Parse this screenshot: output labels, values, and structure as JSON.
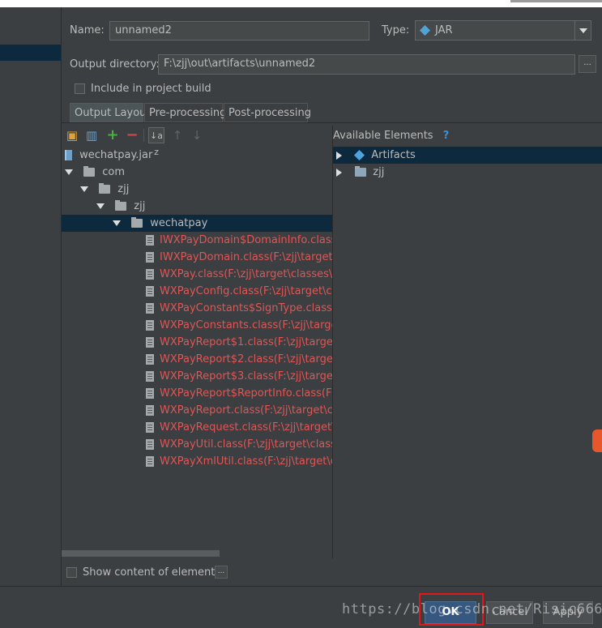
{
  "form": {
    "name_label": "Name:",
    "name_value": "unnamed2",
    "type_label": "Type:",
    "type_value": "JAR",
    "output_dir_label": "Output directory:",
    "output_dir_value": "F:\\zjj\\out\\artifacts\\unnamed2",
    "browse_label": "...",
    "include_build_label": "Include in project build"
  },
  "tabs": [
    {
      "label": "Output Layout",
      "active": true
    },
    {
      "label": "Pre-processing",
      "active": false
    },
    {
      "label": "Post-processing",
      "active": false
    }
  ],
  "toolbar": {
    "add_label": "+",
    "remove_label": "−",
    "sort_label": "↓a z",
    "up_label": "↑",
    "down_label": "↓"
  },
  "tree": {
    "root": "wechatpay.jar",
    "folders": [
      "com",
      "zjj",
      "zjj",
      "wechatpay"
    ],
    "files": [
      "IWXPayDomain$DomainInfo.class(F:\\",
      "IWXPayDomain.class(F:\\zjj\\target\\cla",
      "WXPay.class(F:\\zjj\\target\\classes\\con",
      "WXPayConfig.class(F:\\zjj\\target\\class",
      "WXPayConstants$SignType.class(F:\\z",
      "WXPayConstants.class(F:\\zjj\\target\\cl",
      "WXPayReport$1.class(F:\\zjj\\target\\cla",
      "WXPayReport$2.class(F:\\zjj\\target\\cla",
      "WXPayReport$3.class(F:\\zjj\\target\\cla",
      "WXPayReport$ReportInfo.class(F:\\zjj\\",
      "WXPayReport.class(F:\\zjj\\target\\class",
      "WXPayRequest.class(F:\\zjj\\target\\clas",
      "WXPayUtil.class(F:\\zjj\\target\\classes\\",
      "WXPayXmlUtil.class(F:\\zjj\\target\\class"
    ]
  },
  "available": {
    "title": "Available Elements",
    "help": "?",
    "items": [
      "Artifacts",
      "zjj"
    ]
  },
  "show_content_label": "Show content of elements",
  "show_content_more": "...",
  "buttons": {
    "ok": "OK",
    "cancel": "Cancel",
    "apply": "Apply"
  },
  "watermark": "https://blog.csdn.net/Risic666",
  "colors": {
    "background": "#3c3f41",
    "selection": "#0d293e",
    "error_text": "#e05555",
    "ok_button": "#365880",
    "highlight_box": "#e0181b"
  }
}
